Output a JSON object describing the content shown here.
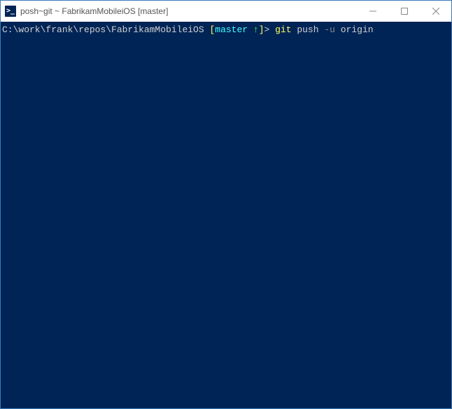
{
  "titlebar": {
    "icon_glyph": ">_",
    "title": "posh~git ~ FabrikamMobileiOS [master]"
  },
  "window_controls": {
    "minimize_label": "Minimize",
    "maximize_label": "Maximize",
    "close_label": "Close"
  },
  "prompt": {
    "path": "C:\\work\\frank\\repos\\FabrikamMobileiOS",
    "bracket_open": " [",
    "branch": "master",
    "branch_arrow": " ↑",
    "bracket_close": "]",
    "prompt_end": "> ",
    "git": "git ",
    "push": "push ",
    "flag": "-u ",
    "origin": "origin"
  }
}
